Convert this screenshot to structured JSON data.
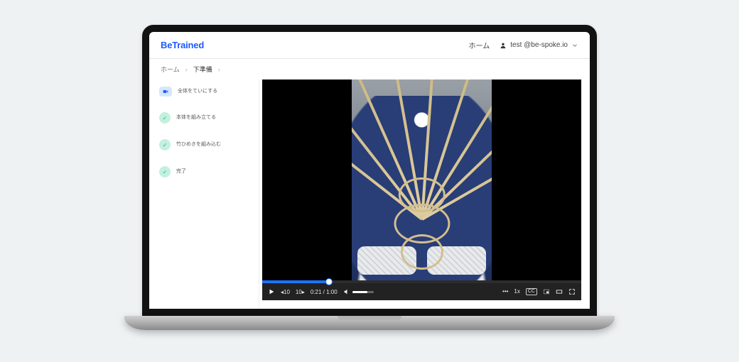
{
  "header": {
    "logo": "BeTrained",
    "nav_home": "ホーム",
    "user_label": "test @be-spoke.io"
  },
  "breadcrumb": {
    "items": [
      "ホーム",
      "下準備"
    ],
    "sep": "›"
  },
  "sidebar": {
    "steps": [
      {
        "label": "全体をていにする",
        "state": "current"
      },
      {
        "label": "本体を組み立てる",
        "state": "done"
      },
      {
        "label": "竹ひめきを組み込む",
        "state": "done"
      },
      {
        "label": "完了",
        "state": "done"
      }
    ]
  },
  "player": {
    "rewind_label": "◂10",
    "forward_label": "10▸",
    "current_time": "0:21",
    "duration": "1:00",
    "time_sep": " / ",
    "rate": "1x",
    "cc_label": "CC",
    "more_label": "•••"
  }
}
